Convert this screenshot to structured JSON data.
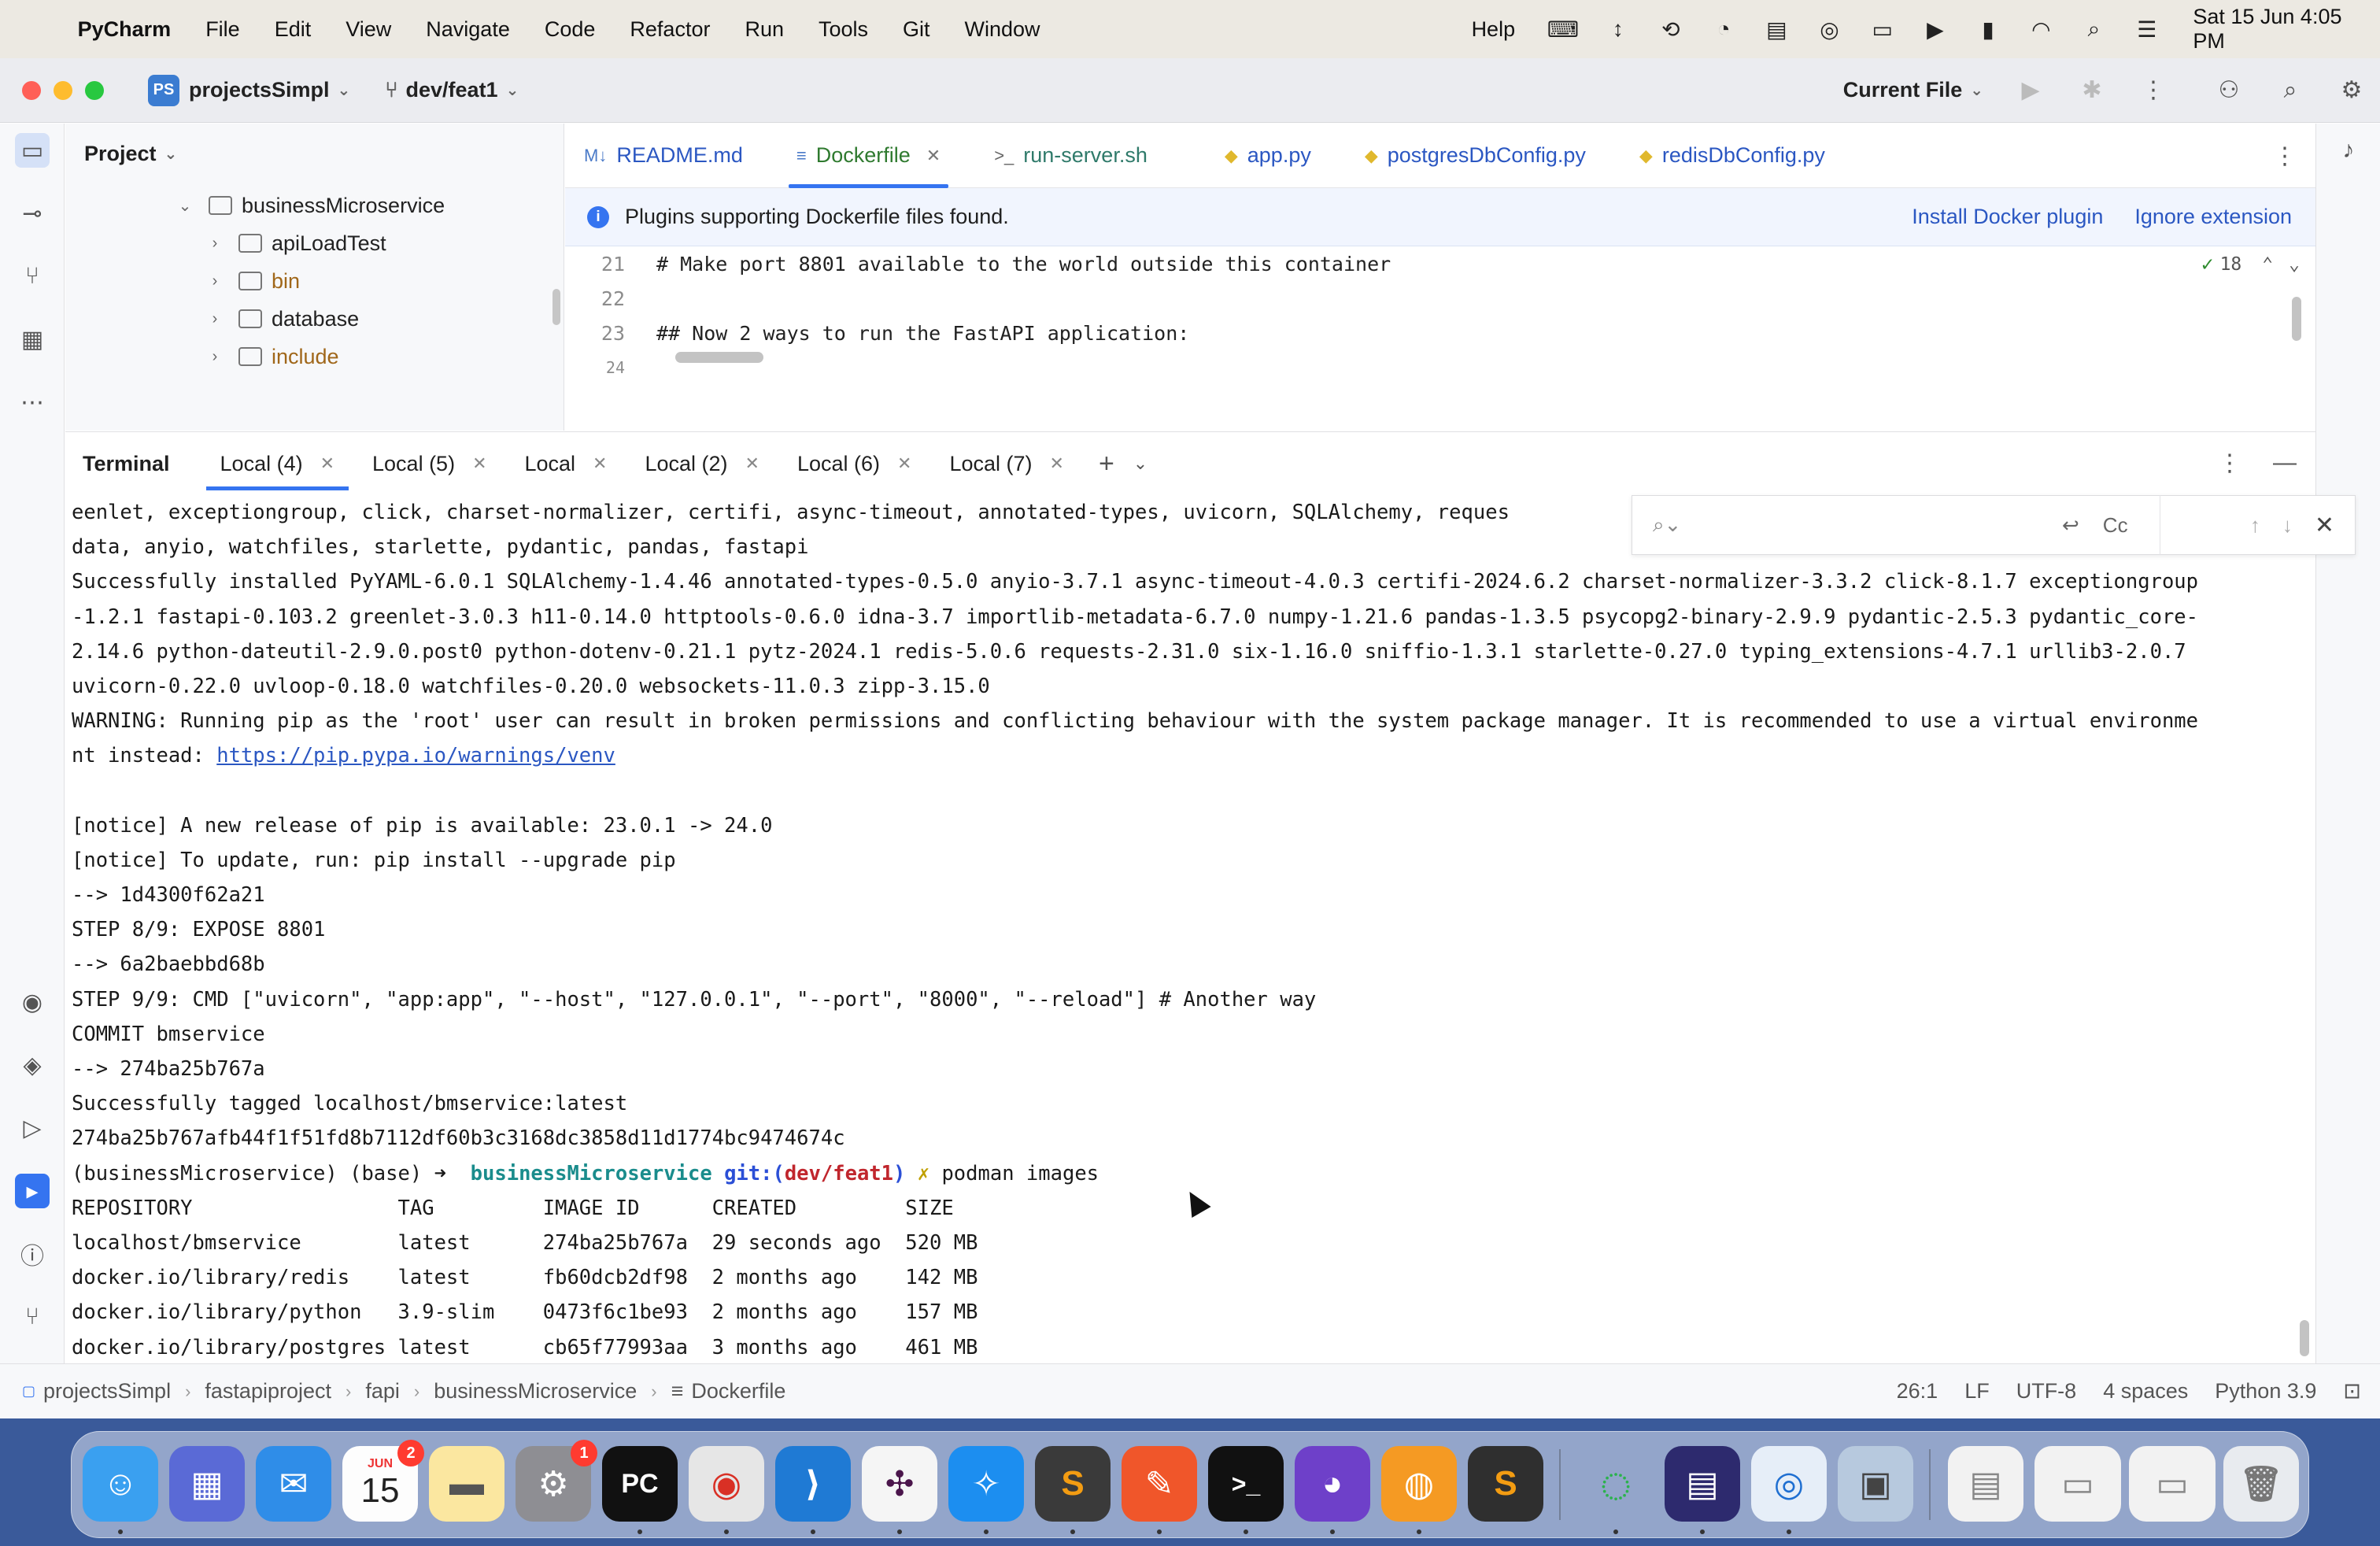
{
  "menubar": {
    "app_name": "PyCharm",
    "items": [
      "File",
      "Edit",
      "View",
      "Navigate",
      "Code",
      "Refactor",
      "Run",
      "Tools",
      "Git",
      "Window"
    ],
    "help": "Help",
    "clock": "Sat 15 Jun  4:05 PM"
  },
  "titlebar": {
    "project_badge": "PS",
    "project_name": "projectsSimpl",
    "branch": "dev/feat1",
    "run_config": "Current File"
  },
  "project_panel": {
    "title": "Project",
    "tree": [
      {
        "name": "businessMicroservice",
        "expanded": true,
        "level": 1
      },
      {
        "name": "apiLoadTest",
        "expanded": false,
        "level": 2
      },
      {
        "name": "bin",
        "expanded": false,
        "level": 2
      },
      {
        "name": "database",
        "expanded": false,
        "level": 2
      },
      {
        "name": "include",
        "expanded": false,
        "level": 2
      }
    ]
  },
  "editor": {
    "tabs": [
      {
        "label": "README.md",
        "icon": "M↓"
      },
      {
        "label": "Dockerfile",
        "icon": "≡",
        "active": true
      },
      {
        "label": "run-server.sh",
        "icon": ">_"
      },
      {
        "label": "app.py",
        "icon": "◆"
      },
      {
        "label": "postgresDbConfig.py",
        "icon": "◆"
      },
      {
        "label": "redisDbConfig.py",
        "icon": "◆"
      }
    ],
    "notice": {
      "text": "Plugins supporting Dockerfile files found.",
      "install": "Install Docker plugin",
      "ignore": "Ignore extension"
    },
    "inspection_count": "18",
    "lines": [
      {
        "num": "21",
        "text": "# Make port 8801 available to the world outside this container"
      },
      {
        "num": "22",
        "text": ""
      },
      {
        "num": "23",
        "text": "## Now 2 ways to run the FastAPI application:"
      },
      {
        "num": "24",
        "text": ""
      }
    ]
  },
  "terminal": {
    "title": "Terminal",
    "tabs": [
      "Local (4)",
      "Local (5)",
      "Local",
      "Local (2)",
      "Local (6)",
      "Local (7)"
    ],
    "active_tab": 0,
    "find": {
      "match_case": "Cc"
    },
    "lines": [
      "eenlet, exceptiongroup, click, charset-normalizer, certifi, async-timeout, annotated-types, uvicorn, SQLAlchemy, reques",
      "data, anyio, watchfiles, starlette, pydantic, pandas, fastapi",
      "Successfully installed PyYAML-6.0.1 SQLAlchemy-1.4.46 annotated-types-0.5.0 anyio-3.7.1 async-timeout-4.0.3 certifi-2024.6.2 charset-normalizer-3.3.2 click-8.1.7 exceptiongroup",
      "-1.2.1 fastapi-0.103.2 greenlet-3.0.3 h11-0.14.0 httptools-0.6.0 idna-3.7 importlib-metadata-6.7.0 numpy-1.21.6 pandas-1.3.5 psycopg2-binary-2.9.9 pydantic-2.5.3 pydantic_core-",
      "2.14.6 python-dateutil-2.9.0.post0 python-dotenv-0.21.1 pytz-2024.1 redis-5.0.6 requests-2.31.0 six-1.16.0 sniffio-1.3.1 starlette-0.27.0 typing_extensions-4.7.1 urllib3-2.0.7",
      "uvicorn-0.22.0 uvloop-0.18.0 watchfiles-0.20.0 websockets-11.0.3 zipp-3.15.0",
      "WARNING: Running pip as the 'root' user can result in broken permissions and conflicting behaviour with the system package manager. It is recommended to use a virtual environme"
    ],
    "warning_tail": "nt instead: ",
    "warning_url": "https://pip.pypa.io/warnings/venv",
    "lines2": [
      "",
      "[notice] A new release of pip is available: 23.0.1 -> 24.0",
      "[notice] To update, run: pip install --upgrade pip",
      "--> 1d4300f62a21",
      "STEP 8/9: EXPOSE 8801",
      "--> 6a2baebbd68b",
      "STEP 9/9: CMD [\"uvicorn\", \"app:app\", \"--host\", \"127.0.0.1\", \"--port\", \"8000\", \"--reload\"] # Another way",
      "COMMIT bmservice",
      "--> 274ba25b767a",
      "Successfully tagged localhost/bmservice:latest",
      "274ba25b767afb44f1f51fd8b7112df60b3c3168dc3858d11d1774bc9474674c"
    ],
    "prompt": {
      "env": "(businessMicroservice) (base) ",
      "arrow": "➜ ",
      "dir": "businessMicroservice",
      "git_label": "git:(",
      "branch": "dev/feat1",
      "git_close": ")",
      "dirty": "✗",
      "command": "podman images"
    },
    "images_table": [
      "REPOSITORY                 TAG         IMAGE ID      CREATED         SIZE",
      "localhost/bmservice        latest      274ba25b767a  29 seconds ago  520 MB",
      "docker.io/library/redis    latest      fb60dcb2df98  2 months ago    142 MB",
      "docker.io/library/python   3.9-slim    0473f6c1be93  2 months ago    157 MB",
      "docker.io/library/postgres latest      cb65f77993aa  3 months ago    461 MB"
    ]
  },
  "statusbar": {
    "crumbs": [
      "projectsSimpl",
      "fastapiproject",
      "fapi",
      "businessMicroservice",
      "Dockerfile"
    ],
    "position": "26:1",
    "line_sep": "LF",
    "encoding": "UTF-8",
    "indent": "4 spaces",
    "interpreter": "Python 3.9"
  },
  "dock": {
    "calendar_month": "JUN",
    "calendar_day": "15",
    "calendar_badge": "2",
    "settings_badge": "1",
    "pycharm_label": "PC"
  }
}
